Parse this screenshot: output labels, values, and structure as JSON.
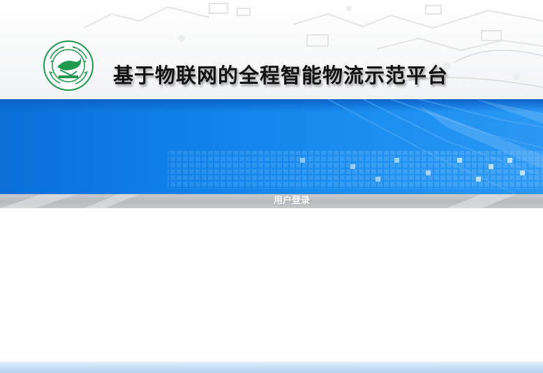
{
  "header": {
    "title": "基于物联网的全程智能物流示范平台",
    "logo": {
      "icon": "university-emblem-icon",
      "ring_text": "BEIJING UNIVERSITY OF POSTS AND TELECOMMUNICATIONS",
      "inner_text": "北京邮电大学"
    }
  },
  "nav": {
    "login_label": "用户登录"
  },
  "colors": {
    "banner_blue": "#1183ea",
    "logo_green": "#1f9a4c",
    "gray_bar": "#bfc1c3",
    "footer_blue": "#c4ddf3"
  }
}
